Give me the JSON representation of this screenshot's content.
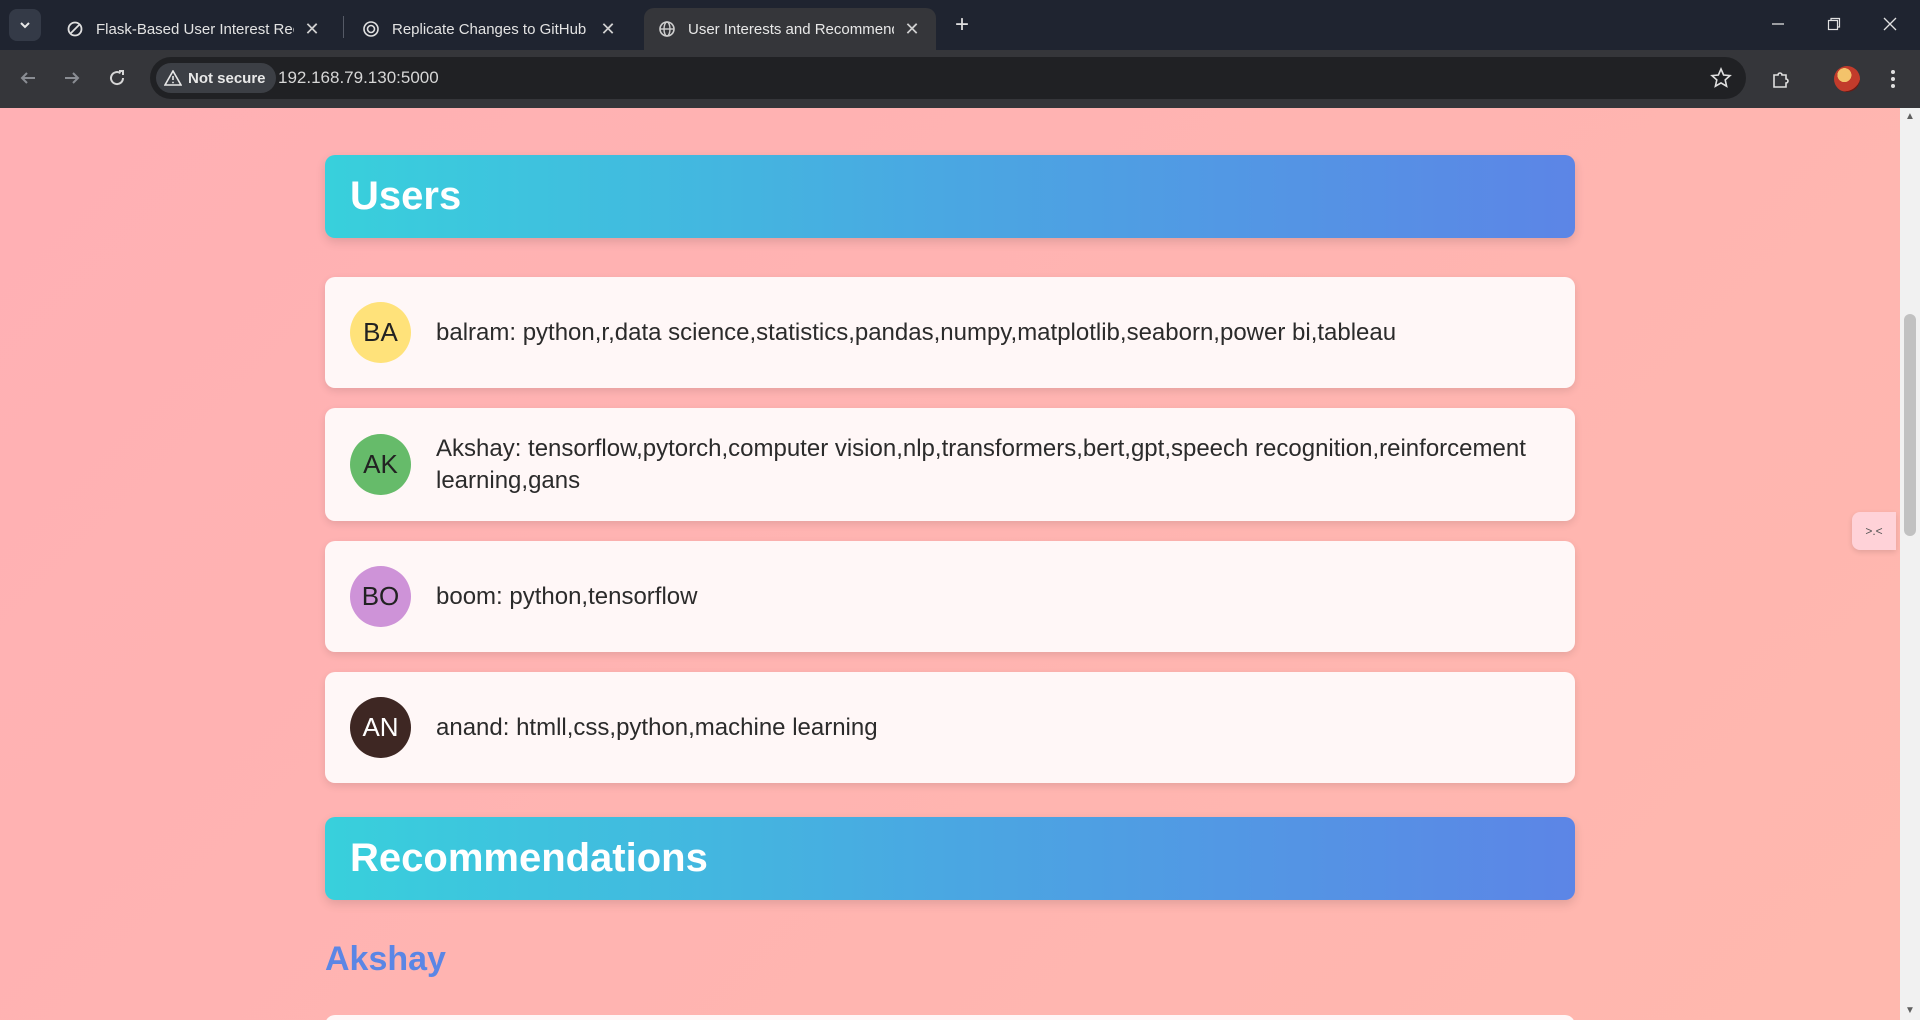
{
  "browser": {
    "tabs": [
      {
        "label": "Flask-Based User Interest Recom",
        "icon": "openai-icon",
        "active": false
      },
      {
        "label": "Replicate Changes to GitHub",
        "icon": "openai-icon",
        "active": false
      },
      {
        "label": "User Interests and Recommenda",
        "icon": "globe-icon",
        "active": true
      }
    ],
    "security_label": "Not secure",
    "url": "192.168.79.130:5000"
  },
  "page": {
    "users_heading": "Users",
    "users": [
      {
        "initials": "BA",
        "text": "balram: python,r,data science,statistics,pandas,numpy,matplotlib,seaborn,power bi,tableau",
        "color": "#ffe27a"
      },
      {
        "initials": "AK",
        "text": "Akshay: tensorflow,pytorch,computer vision,nlp,transformers,bert,gpt,speech recognition,reinforcement learning,gans",
        "color": "#66bb6a"
      },
      {
        "initials": "BO",
        "text": "boom: python,tensorflow",
        "color": "#ce93d8"
      },
      {
        "initials": "AN",
        "text": "anand: htmll,css,python,machine learning",
        "color": "#3e2723"
      }
    ],
    "recommendations_heading": "Recommendations",
    "recommendation_user": "Akshay",
    "widget_glyph": ">.<"
  },
  "colors": {
    "page_bg": "#ffb5b3",
    "header_gradient_start": "#38d0dc",
    "header_gradient_end": "#5c85e6",
    "rec_name": "#5b86e5"
  }
}
